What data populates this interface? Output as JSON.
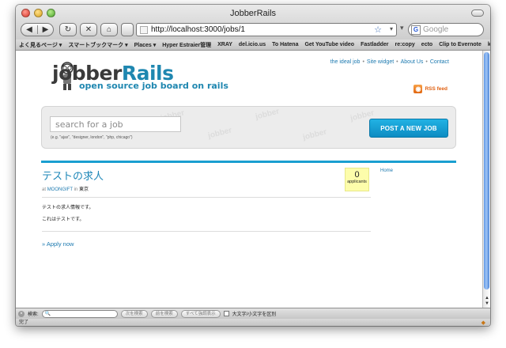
{
  "window": {
    "title": "JobberRails"
  },
  "toolbar": {
    "back_icon": "◀",
    "forward_icon": "▶",
    "reload_icon": "↻",
    "stop_icon": "✕",
    "home_icon": "⌂",
    "address": "http://localhost:3000/jobs/1",
    "search_placeholder": "Google",
    "star_icon": "☆",
    "go_icon": "▾"
  },
  "bookmarks": [
    "よく見るページ ▾",
    "スマートブックマーク ▾",
    "Places ▾",
    "Hyper Estraier管理",
    "XRAY",
    "del.icio.us",
    "To Hatena",
    "Get YouTube video",
    "Fastladder",
    "re:copy",
    "ecto",
    "Clip to Evernote",
    "kwout"
  ],
  "site": {
    "logo_jobber": "jobber",
    "logo_rails": "Rails",
    "tagline": "open source job board on rails",
    "links": [
      "the ideal job",
      "Site widget",
      "About Us",
      "Contact"
    ],
    "link_separator": "•",
    "rss_label": "RSS feed",
    "search_placeholder": "search for a job",
    "search_hint": "(e.g. \"ajax\", \"designer, london\", \"php, chicago\")",
    "post_button": "POST A NEW JOB",
    "watermark": "jobber"
  },
  "job": {
    "title": "テストの求人",
    "at_label": "at",
    "company": "MOONGIFT",
    "in_label": "in",
    "location": "東京",
    "applicants_count": "0",
    "applicants_label": "applicants",
    "description_lines": [
      "テストの求人情報です。",
      "これはテストです。"
    ],
    "apply_link": "» Apply now"
  },
  "sidebar": {
    "home_link": "Home"
  },
  "findbar": {
    "label": "検索:",
    "prev_button": "次を検索",
    "next_button": "前を検索",
    "highlight_button": "すべて強調表示",
    "match_case_label": "大文字/小文字を区別"
  },
  "status": {
    "text": "完了"
  },
  "colors": {
    "brand_blue": "#1f87b0",
    "post_button": "#15a0d6",
    "applicants_bg": "#fdfdab",
    "rss_orange": "#e06010"
  }
}
